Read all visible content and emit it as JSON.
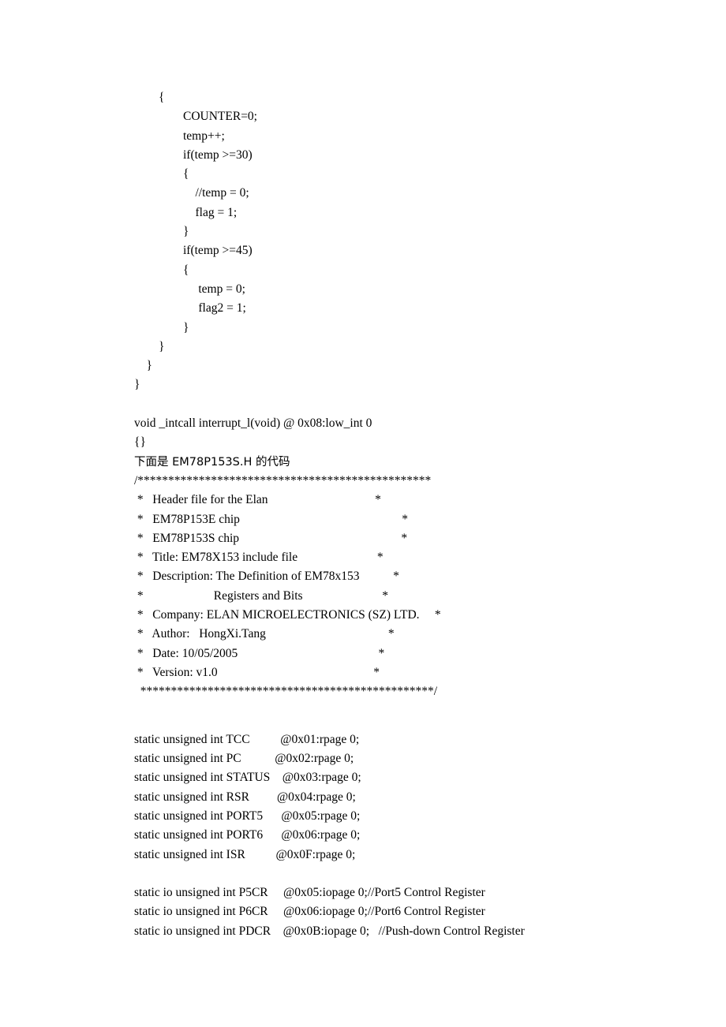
{
  "document": {
    "code_block_1": [
      "        {",
      "                COUNTER=0;",
      "                temp++;",
      "                if(temp >=30)",
      "                {",
      "                    //temp = 0;",
      "                    flag = 1;",
      "                }",
      "                if(temp >=45)",
      "                {",
      "                     temp = 0;",
      "                     flag2 = 1;",
      "                }",
      "        }",
      "    }",
      "}"
    ],
    "code_block_2": [
      "void _intcall interrupt_l(void) @ 0x08:low_int 0",
      "{}"
    ],
    "cjk_note": "下面是 EM78P153S.H 的代码",
    "header_comment": [
      "/************************************************",
      " *   Header file for the Elan                                   *",
      " *   EM78P153E chip                                                     *",
      " *   EM78P153S chip                                                     *",
      " *   Title: EM78X153 include file                          *",
      " *   Description: The Definition of EM78x153           *",
      " *                       Registers and Bits                          *",
      " *   Company: ELAN MICROELECTRONICS (SZ) LTD.     *",
      " *   Author:   HongXi.Tang                                        *",
      " *   Date: 10/05/2005                                              *",
      " *   Version: v1.0                                                   *",
      "  ************************************************/"
    ],
    "register_declarations": [
      "static unsigned int TCC          @0x01:rpage 0;",
      "static unsigned int PC           @0x02:rpage 0;",
      "static unsigned int STATUS    @0x03:rpage 0;",
      "static unsigned int RSR         @0x04:rpage 0;",
      "static unsigned int PORT5      @0x05:rpage 0;",
      "static unsigned int PORT6      @0x06:rpage 0;",
      "static unsigned int ISR          @0x0F:rpage 0;"
    ],
    "io_declarations": [
      "static io unsigned int P5CR     @0x05:iopage 0;//Port5 Control Register",
      "static io unsigned int P6CR     @0x06:iopage 0;//Port6 Control Register",
      "static io unsigned int PDCR    @0x0B:iopage 0;   //Push-down Control Register"
    ]
  }
}
